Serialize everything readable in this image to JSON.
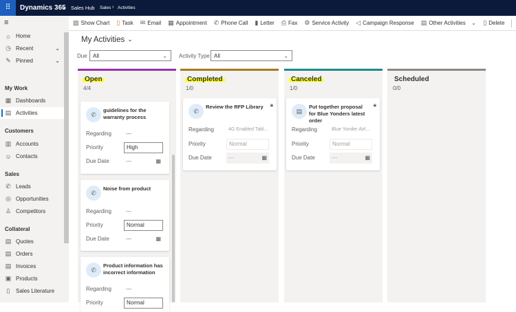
{
  "topbar": {
    "app": "Dynamics 365",
    "area": "Sales Hub",
    "breadcrumb": [
      "Sales",
      "Activities"
    ]
  },
  "commands": [
    {
      "icon": "chart-icon",
      "label": "Show Chart"
    },
    {
      "icon": "task-icon",
      "label": "Task"
    },
    {
      "icon": "email-icon",
      "label": "Email"
    },
    {
      "icon": "calendar-icon",
      "label": "Appointment"
    },
    {
      "icon": "phone-icon",
      "label": "Phone Call"
    },
    {
      "icon": "letter-icon",
      "label": "Letter"
    },
    {
      "icon": "fax-icon",
      "label": "Fax"
    },
    {
      "icon": "service-icon",
      "label": "Service Activity"
    },
    {
      "icon": "megaphone-icon",
      "label": "Campaign Response"
    },
    {
      "icon": "clipboard-icon",
      "label": "Other Activities"
    },
    {
      "icon": "trash-icon",
      "label": "Delete"
    }
  ],
  "sidebar": {
    "top": [
      {
        "label": "Home"
      },
      {
        "label": "Recent"
      },
      {
        "label": "Pinned"
      }
    ],
    "groups": [
      {
        "title": "My Work",
        "items": [
          "Dashboards",
          "Activities"
        ]
      },
      {
        "title": "Customers",
        "items": [
          "Accounts",
          "Contacts"
        ]
      },
      {
        "title": "Sales",
        "items": [
          "Leads",
          "Opportunities",
          "Competitors"
        ]
      },
      {
        "title": "Collateral",
        "items": [
          "Quotes",
          "Orders",
          "Invoices",
          "Products",
          "Sales Literature"
        ]
      }
    ]
  },
  "view": {
    "title": "My Activities",
    "due_label": "Due",
    "due_value": "All",
    "type_label": "Activity Type",
    "type_value": "All"
  },
  "colors": {
    "open": "#9b2fae",
    "completed": "#a5791d",
    "canceled": "#1e8a8a",
    "scheduled": "#8a8886"
  },
  "labels": {
    "regarding": "Regarding",
    "priority": "Priority",
    "due": "Due Date",
    "empty": "---"
  },
  "columns": [
    {
      "title": "Open",
      "count": "4/4",
      "cards": [
        {
          "title": "guidelines for the warranty process",
          "regarding": "---",
          "priority": "High",
          "due": "---"
        },
        {
          "title": "Noise from product",
          "regarding": "---",
          "priority": "Normal",
          "due": "---"
        },
        {
          "title": "Product information has incorrect information",
          "regarding": "---",
          "priority": "Normal"
        }
      ]
    },
    {
      "title": "Completed",
      "count": "1/0",
      "cards": [
        {
          "title": "Review the RFP Library",
          "regarding": "4G Enabled Tabl...",
          "priority": "Normal",
          "due": "---"
        }
      ]
    },
    {
      "title": "Canceled",
      "count": "1/0",
      "cards": [
        {
          "title": "Put together proposal for Blue Yonders latest order",
          "regarding": "Blue Yonder Airl...",
          "priority": "Normal",
          "due": "---"
        }
      ]
    },
    {
      "title": "Scheduled",
      "count": "0/0",
      "cards": []
    }
  ]
}
